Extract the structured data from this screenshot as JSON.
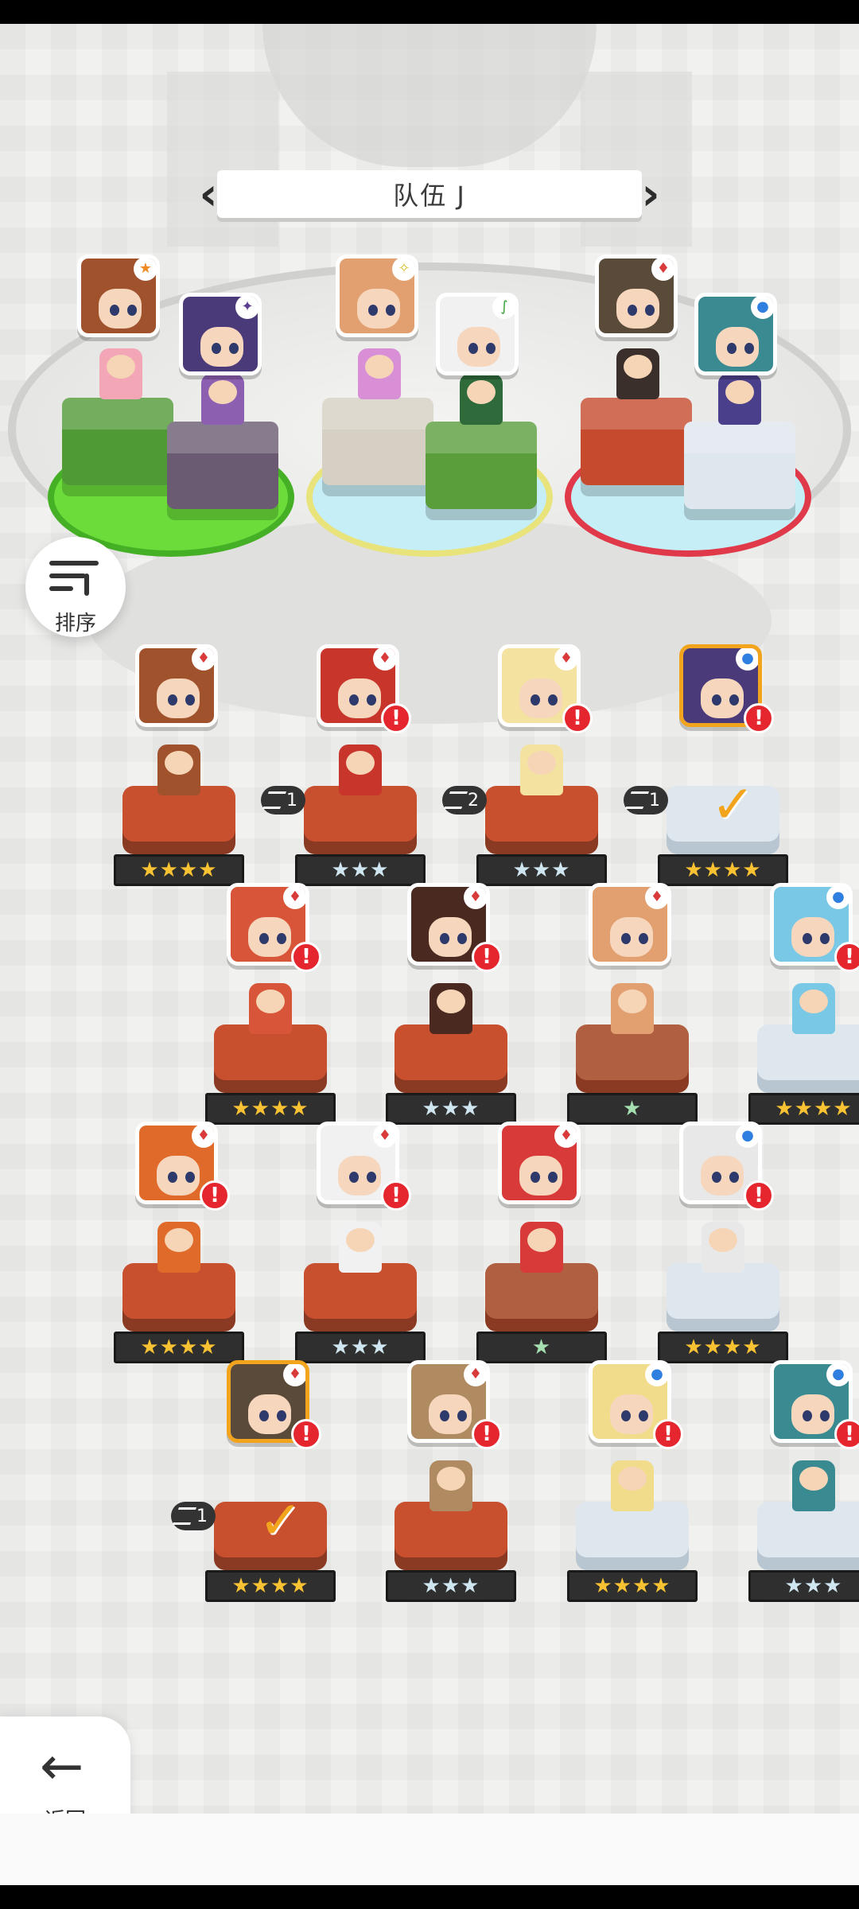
{
  "team": {
    "title": "队伍 J",
    "prev_icon": "chevron-left-icon",
    "next_icon": "chevron-right-icon"
  },
  "sort_button": {
    "label": "排序",
    "icon": "sort-icon"
  },
  "back_button": {
    "label": "返回",
    "icon": "arrow-left-icon"
  },
  "team_slots": [
    {
      "element": "star",
      "color": "#f0a33a"
    },
    {
      "element": "dark",
      "color": "#6b4a9a"
    },
    {
      "element": "light",
      "color": "#d8c95b"
    },
    {
      "element": "earth",
      "color": "#52a43a"
    },
    {
      "element": "fire",
      "color": "#d63a3a"
    },
    {
      "element": "water",
      "color": "#3c84d8"
    }
  ],
  "heroes": [
    {
      "stars": "★★★★",
      "tier": "gold",
      "element": "fire",
      "alert": false,
      "gear": "",
      "selected": false,
      "in_team": false
    },
    {
      "stars": "★★★",
      "tier": "silver",
      "element": "fire",
      "alert": true,
      "gear": "1",
      "selected": false,
      "in_team": false
    },
    {
      "stars": "★★★",
      "tier": "silver",
      "element": "fire",
      "alert": true,
      "gear": "2",
      "selected": false,
      "in_team": false
    },
    {
      "stars": "★★★★",
      "tier": "gold",
      "element": "water",
      "alert": true,
      "gear": "1",
      "selected": true,
      "in_team": true
    },
    {
      "stars": "★★★★",
      "tier": "gold",
      "element": "fire",
      "alert": true,
      "gear": "",
      "selected": false,
      "in_team": false
    },
    {
      "stars": "★★★",
      "tier": "silver",
      "element": "fire",
      "alert": true,
      "gear": "",
      "selected": false,
      "in_team": false
    },
    {
      "stars": "★",
      "tier": "green",
      "element": "fire",
      "alert": false,
      "gear": "",
      "selected": false,
      "in_team": false
    },
    {
      "stars": "★★★★",
      "tier": "gold",
      "element": "water",
      "alert": true,
      "gear": "",
      "selected": false,
      "in_team": false
    },
    {
      "stars": "★★★★",
      "tier": "gold",
      "element": "fire",
      "alert": true,
      "gear": "",
      "selected": false,
      "in_team": false
    },
    {
      "stars": "★★★",
      "tier": "silver",
      "element": "fire",
      "alert": true,
      "gear": "",
      "selected": false,
      "in_team": false
    },
    {
      "stars": "★",
      "tier": "green",
      "element": "fire",
      "alert": false,
      "gear": "",
      "selected": false,
      "in_team": false
    },
    {
      "stars": "★★★★",
      "tier": "gold",
      "element": "water",
      "alert": true,
      "gear": "",
      "selected": false,
      "in_team": false
    },
    {
      "stars": "★★★★",
      "tier": "gold",
      "element": "fire",
      "alert": true,
      "gear": "1",
      "selected": true,
      "in_team": true
    },
    {
      "stars": "★★★",
      "tier": "silver",
      "element": "fire",
      "alert": true,
      "gear": "",
      "selected": false,
      "in_team": false
    },
    {
      "stars": "★★★★",
      "tier": "gold",
      "element": "water",
      "alert": true,
      "gear": "",
      "selected": false,
      "in_team": false
    },
    {
      "stars": "★★★",
      "tier": "silver",
      "element": "water",
      "alert": true,
      "gear": "",
      "selected": false,
      "in_team": false
    }
  ],
  "element_icons": {
    "fire": "♦",
    "water": "●",
    "dark": "✦",
    "light": "✧",
    "earth": "∫",
    "star": "★"
  },
  "alert_text": "!"
}
